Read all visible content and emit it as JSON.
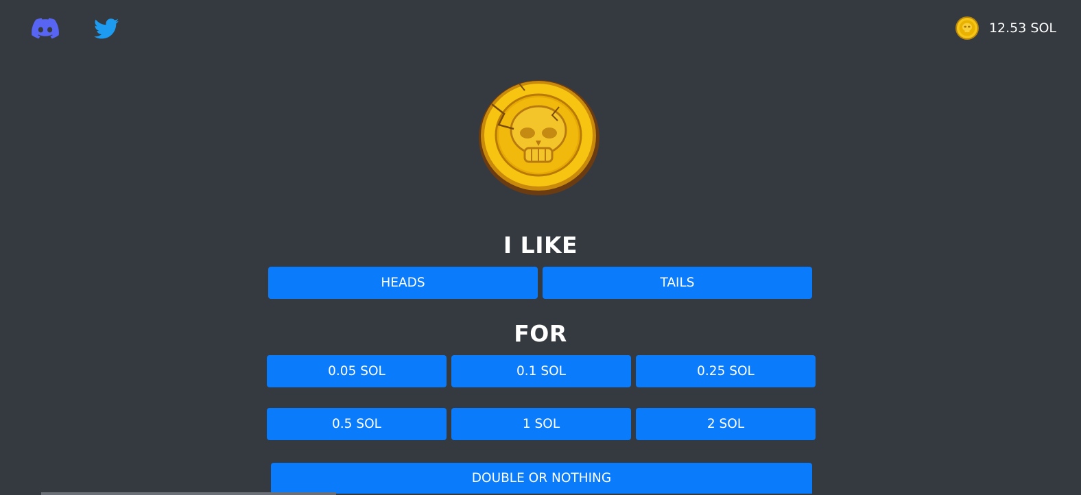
{
  "header": {
    "social": [
      {
        "name": "discord-icon",
        "color": "#5865f2"
      },
      {
        "name": "twitter-icon",
        "color": "#1d9bf0"
      }
    ],
    "balance": {
      "icon": "skull-coin-icon",
      "text": "12.53 SOL"
    }
  },
  "main": {
    "coin_icon": "skull-coin-icon",
    "side_heading": "I LIKE",
    "sides": [
      {
        "label": "HEADS"
      },
      {
        "label": "TAILS"
      }
    ],
    "amount_heading": "FOR",
    "amounts": [
      {
        "label": "0.05 SOL"
      },
      {
        "label": "0.1 SOL"
      },
      {
        "label": "0.25 SOL"
      },
      {
        "label": "0.5 SOL"
      },
      {
        "label": "1 SOL"
      },
      {
        "label": "2 SOL"
      }
    ],
    "action_label": "DOUBLE OR NOTHING"
  },
  "colors": {
    "background": "#353a41",
    "button": "#0a7bfa",
    "coin_gold": "#f5c518"
  }
}
